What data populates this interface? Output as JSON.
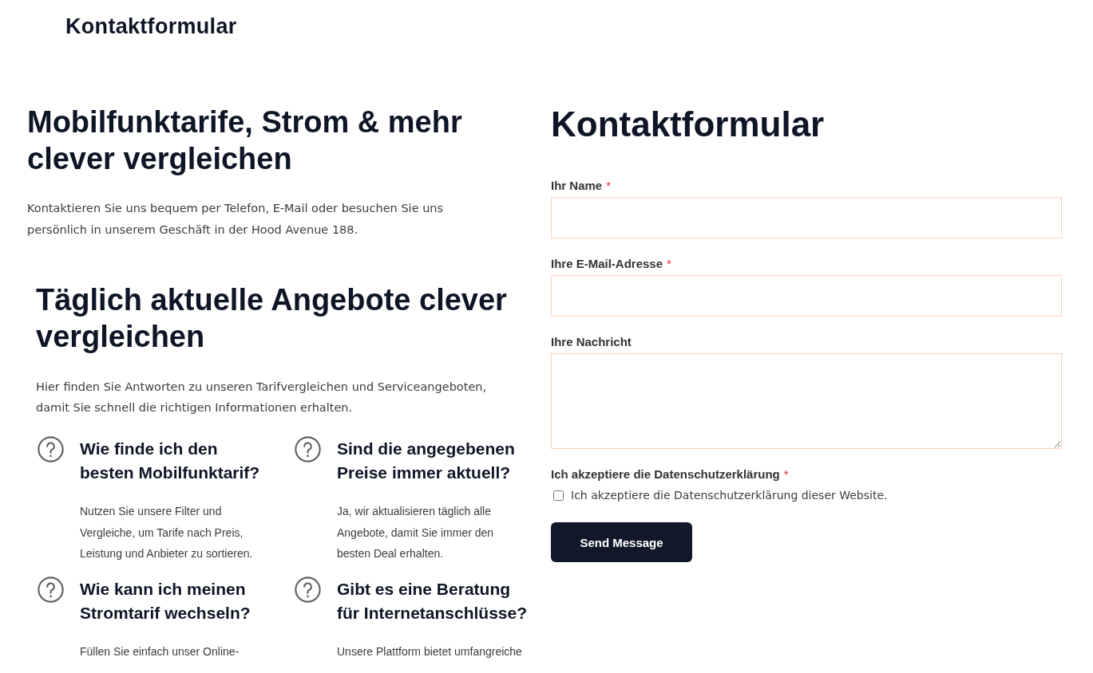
{
  "header": {
    "title": "Kontaktformular"
  },
  "intro": {
    "heading": "Mobilfunktarife, Strom & mehr clever vergleichen",
    "text": "Kontaktieren Sie uns bequem per Telefon, E-Mail oder besuchen Sie uns persönlich in unserem Geschäft in der Hood Avenue 188."
  },
  "offers": {
    "heading": "Täglich aktuelle Angebote clever vergleichen",
    "text": "Hier finden Sie Antworten zu unseren Tarifvergleichen und Serviceangeboten, damit Sie schnell die richtigen Informationen erhalten.",
    "faq": [
      {
        "question": "Wie finde ich den besten Mobilfunktarif?",
        "answer": "Nutzen Sie unsere Filter und Vergleiche, um Tarife nach Preis, Leistung und Anbieter zu sortieren."
      },
      {
        "question": "Sind die angegebenen Preise immer aktuell?",
        "answer": "Ja, wir aktualisieren täglich alle Angebote, damit Sie immer den besten Deal erhalten."
      },
      {
        "question": "Wie kann ich meinen Stromtarif wechseln?",
        "answer": "Füllen Sie einfach unser Online-"
      },
      {
        "question": "Gibt es eine Beratung für Internetanschlüsse?",
        "answer": "Unsere Plattform bietet umfangreiche"
      }
    ]
  },
  "contact_form": {
    "title": "Kontaktformular",
    "fields": [
      {
        "kind": "text",
        "label": "Ihr Name",
        "required_mark": "*"
      },
      {
        "kind": "email",
        "label": "Ihre E-Mail-Adresse",
        "required_mark": "*"
      },
      {
        "kind": "textarea",
        "label": "Ihre Nachricht"
      }
    ],
    "consent": {
      "label": "Ich akzeptiere die Datenschutzerklärung",
      "required_mark": "*",
      "checkbox_label": "Ich akzeptiere die Datenschutzerklärung dieser Website.",
      "checked": false
    },
    "submit": "Send Message"
  }
}
